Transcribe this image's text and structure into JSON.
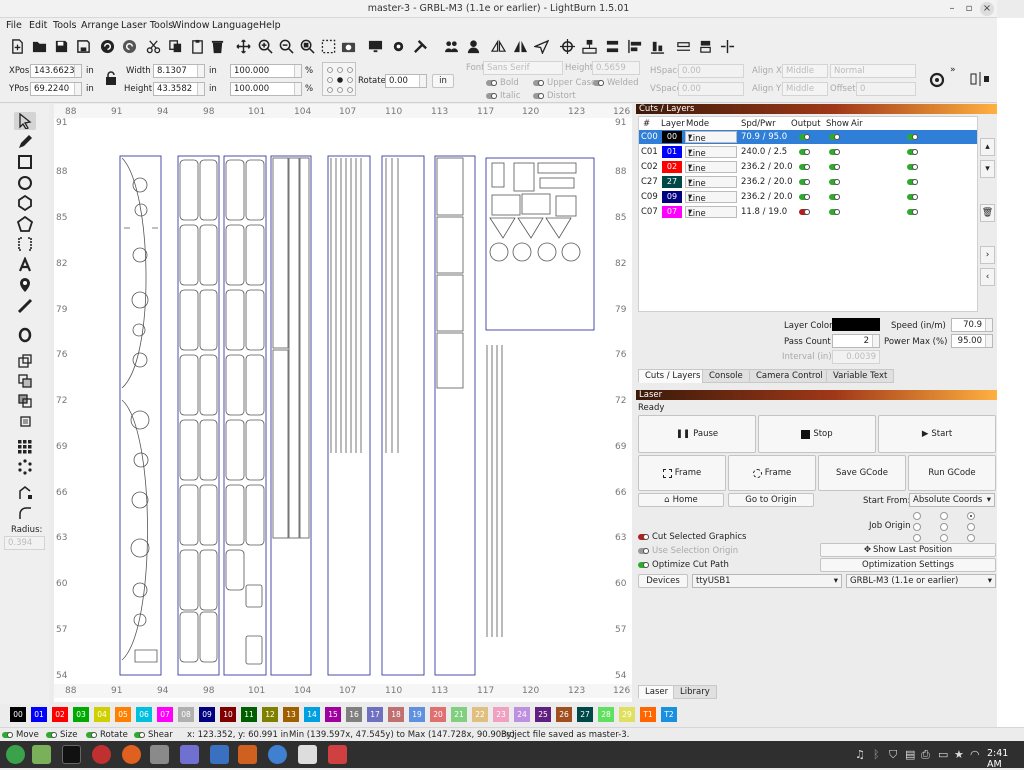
{
  "title_bar": {
    "title": "master-3 - GRBL-M3 (1.1e or earlier) - LightBurn 1.5.01"
  },
  "menu": [
    "File",
    "Edit",
    "Tools",
    "Arrange",
    "Laser Tools",
    "Window",
    "Language",
    "Help"
  ],
  "toolbar_icons": [
    "new-file",
    "open",
    "save",
    "undo",
    "redo",
    "cut",
    "copy",
    "paste",
    "delete",
    "move",
    "zoom-in",
    "zoom-out",
    "zoom-frame",
    "select-all",
    "camera",
    "monitor",
    "settings",
    "tools",
    "group",
    "user",
    "mirror-h",
    "mirror-v",
    "send",
    "center",
    "align",
    "distribute",
    "grid-align",
    "resize",
    "push"
  ],
  "props": {
    "xpos_label": "XPos",
    "xpos_value": "143.6623",
    "xpos_unit": "in",
    "ypos_label": "YPos",
    "ypos_value": "69.2240",
    "ypos_unit": "in",
    "width_label": "Width",
    "width_value": "8.1307",
    "width_unit": "in",
    "height_label": "Height",
    "height_value": "43.3582",
    "height_unit": "in",
    "scale_w": "100.000",
    "scale_h": "100.000",
    "pct": "%",
    "rotate_label": "Rotate",
    "rotate_value": "0.00",
    "rotate_unit": "in",
    "font_label": "Font",
    "font_value": "Sans Serif",
    "fheight_label": "Height",
    "fheight_value": "0.5659",
    "hspace_label": "HSpace",
    "hspace_value": "0.00",
    "vspace_label": "VSpace",
    "vspace_value": "0.00",
    "alignx_label": "Align X",
    "alignx_value": "Middle",
    "aligny_label": "Align Y",
    "aligny_value": "Middle",
    "normal_value": "Normal",
    "offset_label": "Offset",
    "offset_value": "0",
    "bold": "Bold",
    "italic": "Italic",
    "upper": "Upper Case",
    "distort": "Distort",
    "welded": "Welded"
  },
  "ruler": {
    "top": [
      "88",
      "91",
      "94",
      "98",
      "101",
      "104",
      "107",
      "110",
      "113",
      "117",
      "120",
      "123",
      "126"
    ],
    "left": [
      "91",
      "88",
      "85",
      "82",
      "79",
      "76",
      "72",
      "69",
      "66",
      "63",
      "60",
      "57",
      "54"
    ]
  },
  "left_tools": [
    "select-tool",
    "pencil-tool",
    "rectangle-tool",
    "ellipse-tool",
    "polygon-tool",
    "shape-tool",
    "bracket-tool",
    "text-tool",
    "position-tool",
    "measure-tool",
    "offset-tool",
    "group-tool",
    "ungroup-tool",
    "boolean-tool",
    "weld-tool",
    "array-tool",
    "circular-array-tool",
    "rounding-tool",
    "corner-tool"
  ],
  "radius_label": "Radius:",
  "radius_value": "0.394",
  "cuts": {
    "panel_title": "Cuts / Layers",
    "headers": [
      "#",
      "Layer",
      "Mode",
      "Spd/Pwr",
      "Output",
      "Show",
      "Air"
    ],
    "rows": [
      {
        "num": "C00",
        "layer": "00",
        "color": "#000000",
        "mode": "Line",
        "spd": "70.9 / 95.0",
        "output": "on"
      },
      {
        "num": "C01",
        "layer": "01",
        "color": "#0000ff",
        "mode": "Line",
        "spd": "240.0 / 2.5",
        "output": "on"
      },
      {
        "num": "C02",
        "layer": "02",
        "color": "#ff0000",
        "mode": "Line",
        "spd": "236.2 / 20.0",
        "output": "on"
      },
      {
        "num": "C27",
        "layer": "27",
        "color": "#004848",
        "mode": "Line",
        "spd": "236.2 / 20.0",
        "output": "on"
      },
      {
        "num": "C09",
        "layer": "09",
        "color": "#000080",
        "mode": "Line",
        "spd": "236.2 / 20.0",
        "output": "on"
      },
      {
        "num": "C07",
        "layer": "07",
        "color": "#ff00ff",
        "mode": "Line",
        "spd": "11.8 / 19.0",
        "output": "off"
      }
    ],
    "layer_color_label": "Layer Color",
    "speed_label": "Speed (in/m)",
    "speed_value": "70.9",
    "pass_label": "Pass Count",
    "pass_value": "2",
    "power_label": "Power Max (%)",
    "power_value": "95.00",
    "interval_label": "Interval (in)",
    "interval_value": "0.0039",
    "tabs": [
      "Cuts / Layers",
      "Console",
      "Camera Control",
      "Variable Text"
    ]
  },
  "laser": {
    "panel_title": "Laser",
    "status": "Ready",
    "pause": "Pause",
    "stop": "Stop",
    "start": "Start",
    "frame1": "Frame",
    "frame2": "Frame",
    "save_gcode": "Save GCode",
    "run_gcode": "Run GCode",
    "home": "Home",
    "goto_origin": "Go to Origin",
    "start_from_label": "Start From:",
    "start_from_value": "Absolute Coords",
    "job_origin_label": "Job Origin",
    "cut_selected": "Cut Selected Graphics",
    "use_selection": "Use Selection Origin",
    "optimize_cut": "Optimize Cut Path",
    "show_last": "Show Last Position",
    "opt_settings": "Optimization Settings",
    "devices": "Devices",
    "port": "ttyUSB1",
    "device_profile": "GRBL-M3 (1.1e or earlier)",
    "tabs": [
      "Laser",
      "Library"
    ]
  },
  "palette": [
    {
      "l": "00",
      "c": "#000000"
    },
    {
      "l": "01",
      "c": "#0000ff"
    },
    {
      "l": "02",
      "c": "#ff0000"
    },
    {
      "l": "03",
      "c": "#00aa00"
    },
    {
      "l": "04",
      "c": "#d0d000"
    },
    {
      "l": "05",
      "c": "#ff8000"
    },
    {
      "l": "06",
      "c": "#00c0e0"
    },
    {
      "l": "07",
      "c": "#ff00ff"
    },
    {
      "l": "08",
      "c": "#b0b0b0"
    },
    {
      "l": "09",
      "c": "#000080"
    },
    {
      "l": "10",
      "c": "#800000"
    },
    {
      "l": "11",
      "c": "#006000"
    },
    {
      "l": "12",
      "c": "#808000"
    },
    {
      "l": "13",
      "c": "#a06000"
    },
    {
      "l": "14",
      "c": "#00a0e0"
    },
    {
      "l": "15",
      "c": "#a000a0"
    },
    {
      "l": "16",
      "c": "#808080"
    },
    {
      "l": "17",
      "c": "#7070c0"
    },
    {
      "l": "18",
      "c": "#c07070"
    },
    {
      "l": "19",
      "c": "#6090e0"
    },
    {
      "l": "20",
      "c": "#e07070"
    },
    {
      "l": "21",
      "c": "#80d080"
    },
    {
      "l": "22",
      "c": "#e0c080"
    },
    {
      "l": "23",
      "c": "#f0a0c0"
    },
    {
      "l": "24",
      "c": "#c090e0"
    },
    {
      "l": "25",
      "c": "#602080"
    },
    {
      "l": "26",
      "c": "#a05020"
    },
    {
      "l": "27",
      "c": "#004848"
    },
    {
      "l": "28",
      "c": "#60e060"
    },
    {
      "l": "29",
      "c": "#e0e060"
    },
    {
      "l": "T1",
      "c": "#ff6600"
    },
    {
      "l": "T2",
      "c": "#1a90e0"
    }
  ],
  "status": {
    "move": "Move",
    "size": "Size",
    "rotate": "Rotate",
    "shear": "Shear",
    "coords": "x: 123.352, y: 60.991 in",
    "minmax": "Min (139.597x, 47.545y) to Max (147.728x, 90.903y)",
    "message": "Project file saved as master-3."
  },
  "taskbar": {
    "clock": "2:41 AM"
  }
}
